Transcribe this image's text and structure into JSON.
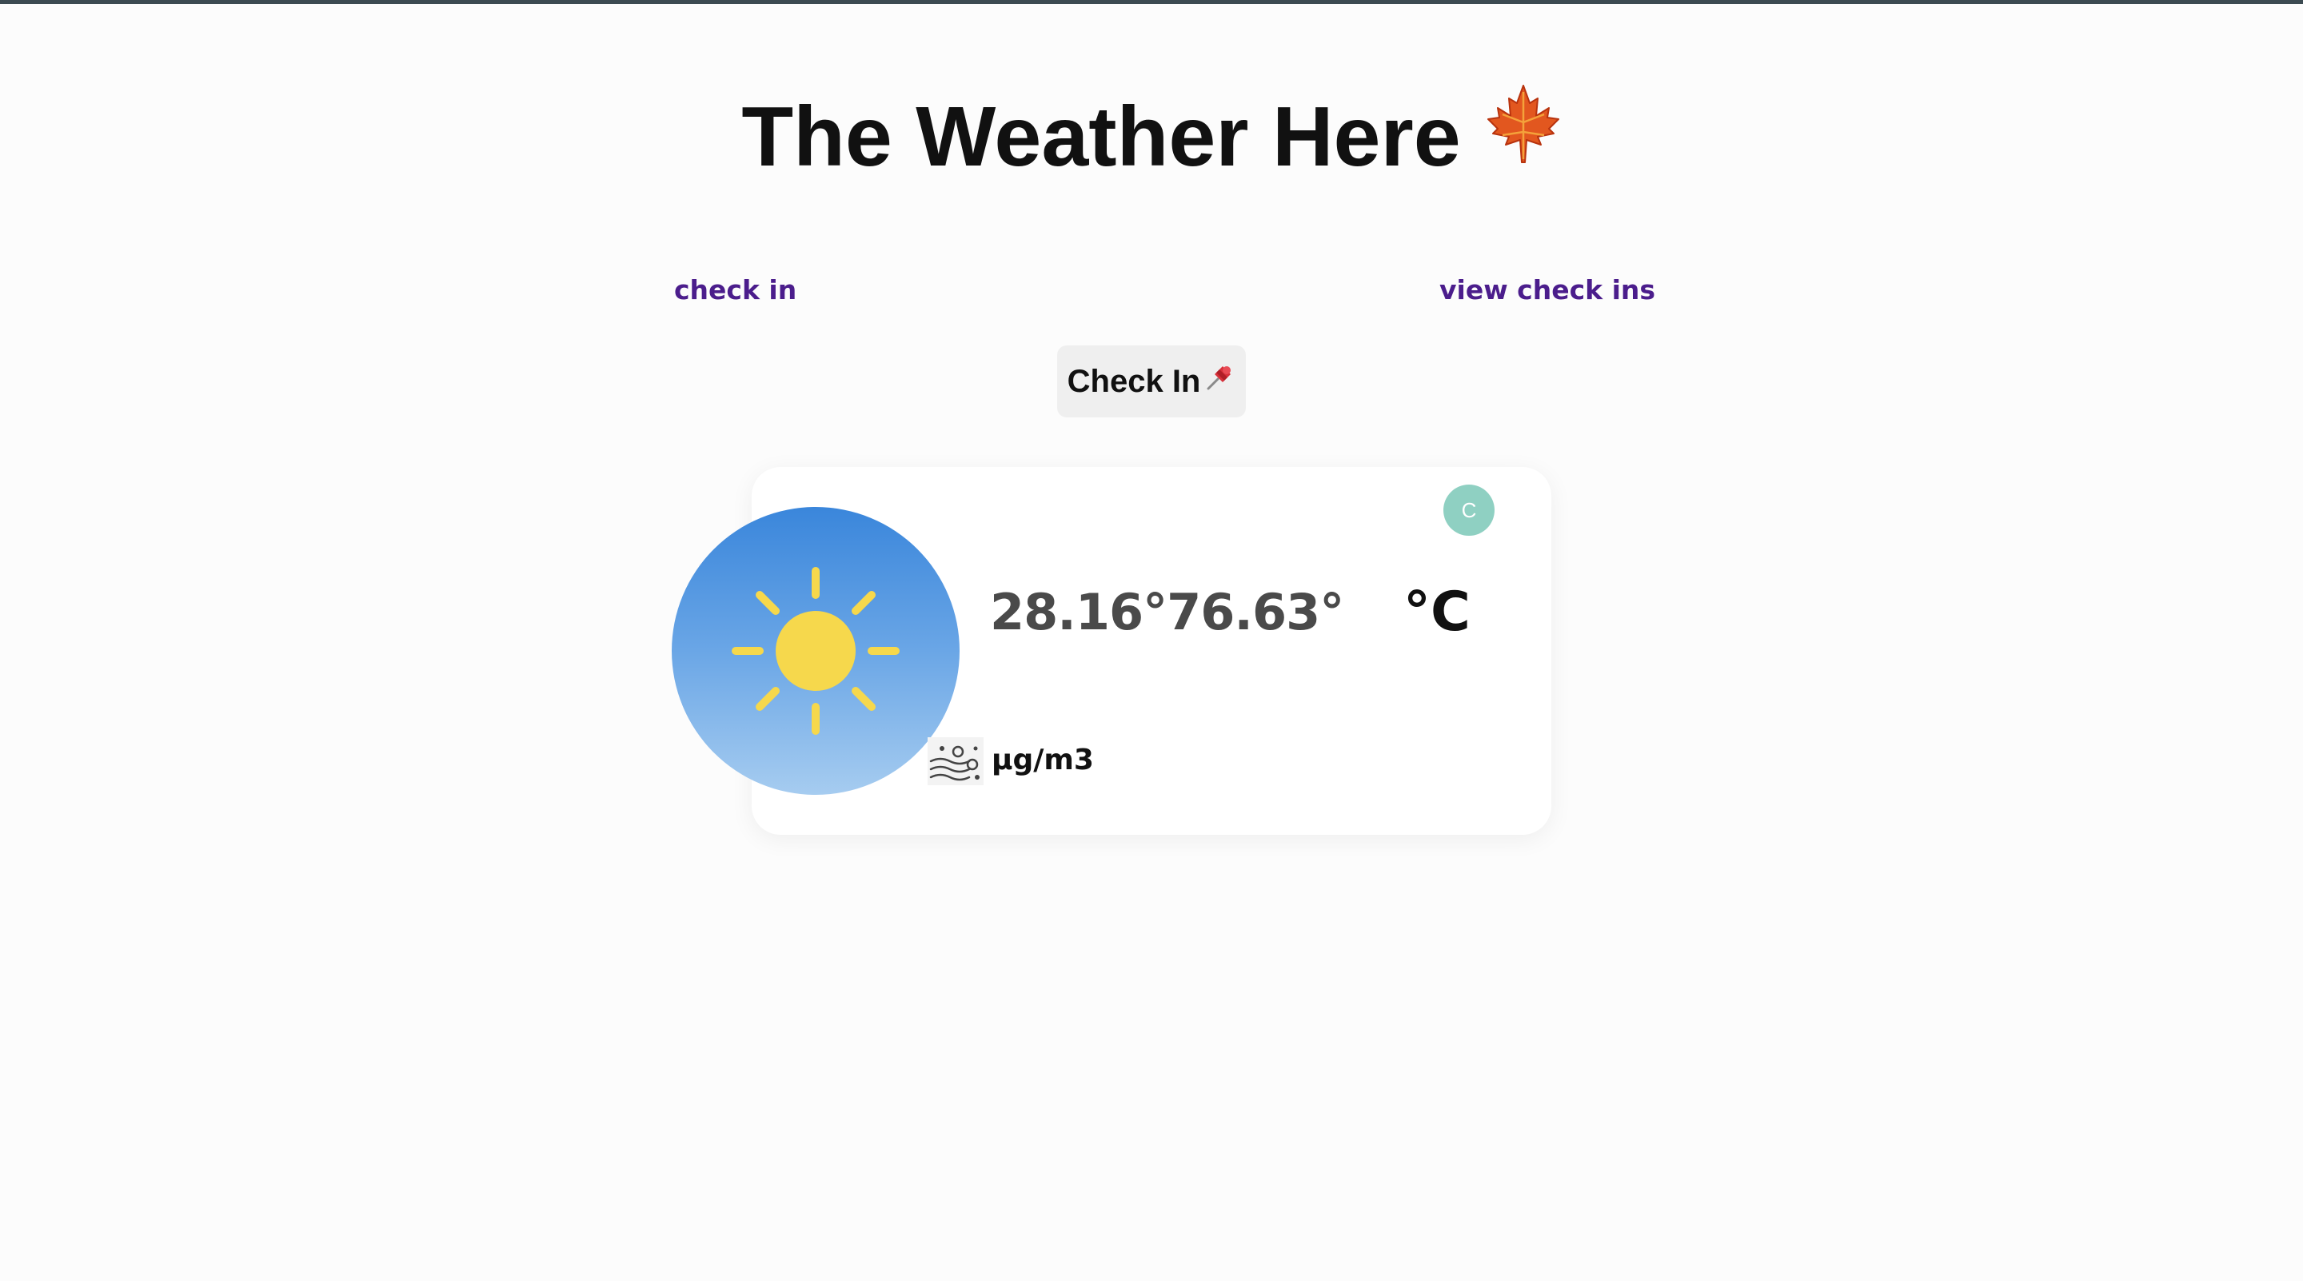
{
  "header": {
    "title": "The Weather Here",
    "title_icon": "maple-leaf-icon"
  },
  "nav": {
    "check_in_link": "check in",
    "view_check_ins_link": "view check ins"
  },
  "check_in_button": {
    "label": "Check In",
    "icon": "pushpin-icon"
  },
  "weather_card": {
    "weather_icon": "sun-icon",
    "temperatures": "28.16°76.63°",
    "unit_toggle_label": "C",
    "unit_label": "°C",
    "air_quality_icon": "air-pollution-icon",
    "air_quality_unit": "μg/m3"
  },
  "colors": {
    "link": "#4b1d8c",
    "toggle": "#8fd0c2",
    "sun": "#f6d84c",
    "sky_top": "#3a86db",
    "sky_bottom": "#a6ccf0"
  }
}
